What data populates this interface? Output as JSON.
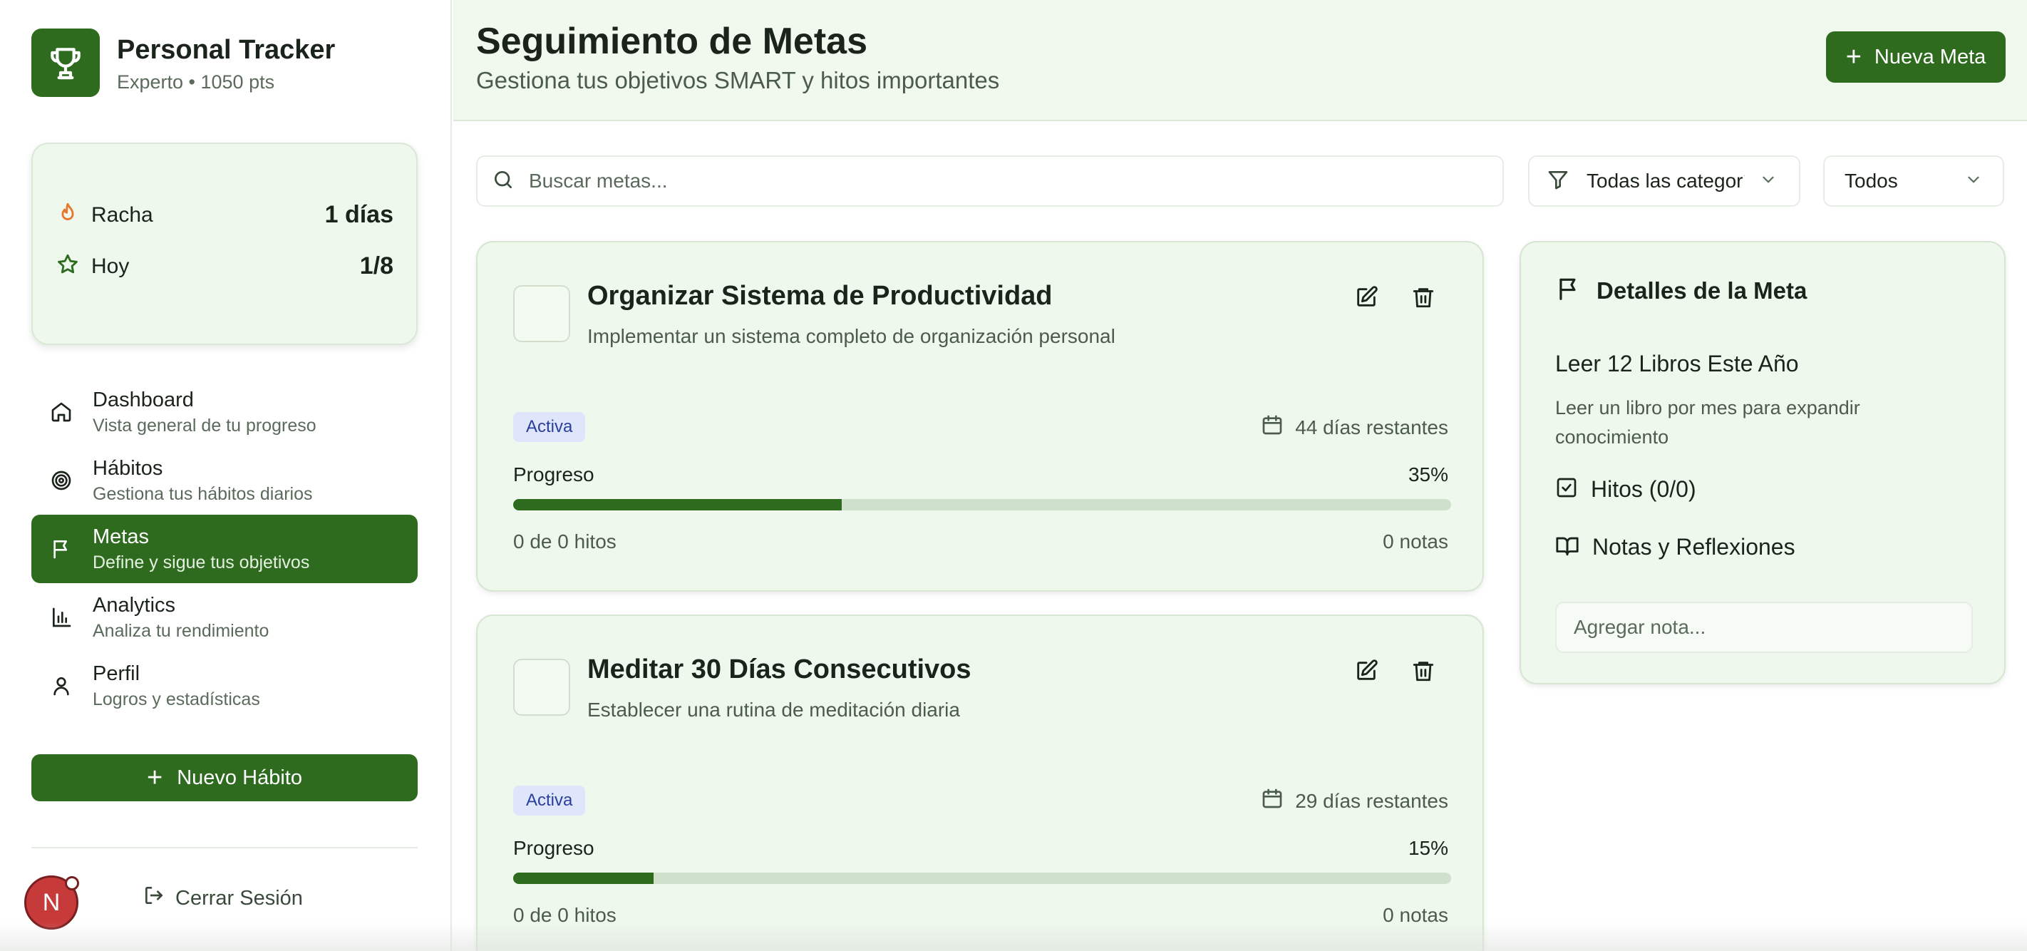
{
  "brand": {
    "title": "Personal Tracker",
    "subtitle": "Experto • 1050 pts"
  },
  "stats": {
    "streak_label": "Racha",
    "streak_value": "1 días",
    "today_label": "Hoy",
    "today_value": "1/8"
  },
  "nav": [
    {
      "label": "Dashboard",
      "desc": "Vista general de tu progreso",
      "icon": "home-icon"
    },
    {
      "label": "Hábitos",
      "desc": "Gestiona tus hábitos diarios",
      "icon": "target-icon"
    },
    {
      "label": "Metas",
      "desc": "Define y sigue tus objetivos",
      "icon": "flag-icon",
      "active": true
    },
    {
      "label": "Analytics",
      "desc": "Analiza tu rendimiento",
      "icon": "bar-chart-icon"
    },
    {
      "label": "Perfil",
      "desc": "Logros y estadísticas",
      "icon": "user-icon"
    }
  ],
  "new_habit_label": "Nuevo Hábito",
  "user": {
    "initial": "N"
  },
  "logout_label": "Cerrar Sesión",
  "header": {
    "title": "Seguimiento de Metas",
    "subtitle": "Gestiona tus objetivos SMART y hitos importantes",
    "new_goal_label": "Nueva Meta"
  },
  "filters": {
    "search_placeholder": "Buscar metas...",
    "category_value": "Todas las categorías",
    "status_value": "Todos"
  },
  "goals": [
    {
      "title": "Organizar Sistema de Productividad",
      "description": "Implementar un sistema completo de organización personal",
      "status": "Activa",
      "days_left": "44 días restantes",
      "progress_label": "Progreso",
      "progress_text": "35%",
      "progress": 0.35,
      "milestones": "0 de 0 hitos",
      "notes": "0 notas"
    },
    {
      "title": "Meditar 30 Días Consecutivos",
      "description": "Establecer una rutina de meditación diaria",
      "status": "Activa",
      "days_left": "29 días restantes",
      "progress_label": "Progreso",
      "progress_text": "15%",
      "progress": 0.15,
      "milestones": "0 de 0 hitos",
      "notes": "0 notas"
    }
  ],
  "detail": {
    "heading": "Detalles de la Meta",
    "goal_title": "Leer 12 Libros Este Año",
    "goal_desc": "Leer un libro por mes para expandir conocimiento",
    "milestones_label": "Hitos (0/0)",
    "notes_label": "Notas y Reflexiones",
    "note_placeholder": "Agregar nota..."
  },
  "colors": {
    "primary": "#2e6b1f",
    "card_bg": "#eef8ec",
    "badge_bg": "#dfe6fb",
    "badge_text": "#2a3f9c",
    "streak_icon": "#e8762b"
  }
}
